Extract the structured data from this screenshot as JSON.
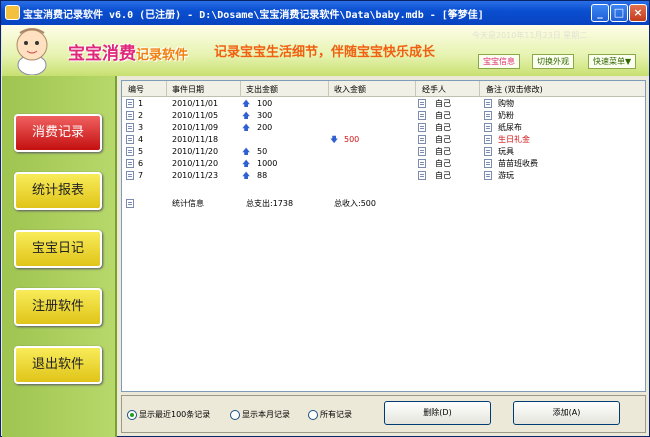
{
  "window": {
    "title": "宝宝消费记录软件 v6.0 (已注册) - D:\\Dosame\\宝宝消费记录软件\\Data\\baby.mdb - [筝梦佳]",
    "minimize": "_",
    "maximize": "□",
    "close": "×"
  },
  "header": {
    "logo_main": "宝宝消费",
    "logo_sub": "记录软件",
    "slogan": "记录宝宝生活细节，伴随宝宝快乐成长",
    "date": "今天是2010年11月23日 星期二",
    "buttons": [
      "宝宝信息",
      "切换外观",
      "快速菜单▼"
    ]
  },
  "sidebar": {
    "items": [
      "消费记录",
      "统计报表",
      "宝宝日记",
      "注册软件",
      "退出软件"
    ]
  },
  "table": {
    "columns": [
      "编号",
      "事件日期",
      "支出金额",
      "收入金额",
      "经手人",
      "备注 (双击修改)"
    ],
    "rows": [
      {
        "id": "1",
        "date": "2010/11/01",
        "expense": "100",
        "income": "",
        "handler": "自己",
        "note": "购物"
      },
      {
        "id": "2",
        "date": "2010/11/05",
        "expense": "300",
        "income": "",
        "handler": "自己",
        "note": "奶粉"
      },
      {
        "id": "3",
        "date": "2010/11/09",
        "expense": "200",
        "income": "",
        "handler": "自己",
        "note": "纸尿布"
      },
      {
        "id": "4",
        "date": "2010/11/18",
        "expense": "",
        "income": "500",
        "handler": "自己",
        "note": "生日礼金"
      },
      {
        "id": "5",
        "date": "2010/11/20",
        "expense": "50",
        "income": "",
        "handler": "自己",
        "note": "玩具"
      },
      {
        "id": "6",
        "date": "2010/11/20",
        "expense": "1000",
        "income": "",
        "handler": "自己",
        "note": "苗苗班收费"
      },
      {
        "id": "7",
        "date": "2010/11/23",
        "expense": "88",
        "income": "",
        "handler": "自己",
        "note": "游玩"
      }
    ],
    "summary": {
      "label": "统计信息",
      "total_expense": "总支出:1738",
      "total_income": "总收入:500"
    }
  },
  "bottom": {
    "radios": [
      {
        "label": "显示最近100条记录",
        "checked": true
      },
      {
        "label": "显示本月记录",
        "checked": false
      },
      {
        "label": "所有记录",
        "checked": false
      }
    ],
    "delete_label": "删除(D)",
    "add_label": "添加(A)"
  },
  "colors": {
    "accent": "#e0287a",
    "income": "#d01010",
    "sidebar_active": "#c41010"
  }
}
